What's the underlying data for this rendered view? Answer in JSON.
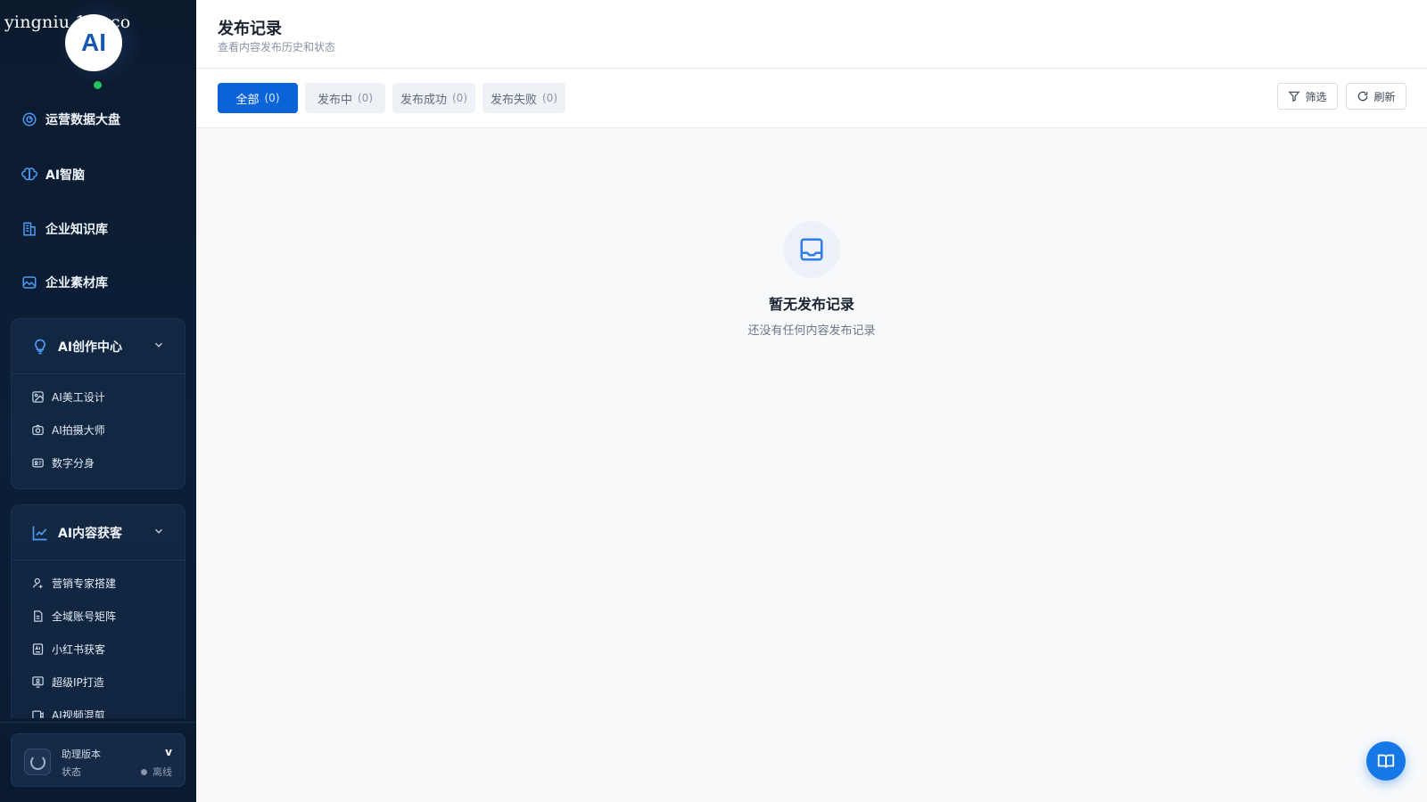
{
  "watermark": "yingniu.10v.co",
  "logo": {
    "text": "AI"
  },
  "nav": [
    {
      "label": "运营数据大盘",
      "icon": "dashboard-icon"
    },
    {
      "label": "AI智脑",
      "icon": "brain-icon"
    },
    {
      "label": "企业知识库",
      "icon": "building-icon"
    },
    {
      "label": "企业素材库",
      "icon": "image-icon"
    }
  ],
  "groups": {
    "creation": {
      "title": "AI创作中心",
      "icon": "lightbulb-icon",
      "items": [
        {
          "label": "AI美工设计",
          "icon": "palette-icon"
        },
        {
          "label": "AI拍摄大师",
          "icon": "camera-icon"
        },
        {
          "label": "数字分身",
          "icon": "id-card-icon"
        }
      ]
    },
    "acquisition": {
      "title": "AI内容获客",
      "icon": "trend-chart-icon",
      "items": [
        {
          "label": "营销专家搭建",
          "icon": "user-icon"
        },
        {
          "label": "全域账号矩阵",
          "icon": "file-icon"
        },
        {
          "label": "小红书获客",
          "icon": "ai-doc-icon"
        },
        {
          "label": "超级IP打造",
          "icon": "monitor-user-icon"
        },
        {
          "label": "AI视频混剪",
          "icon": "video-icon"
        }
      ]
    }
  },
  "status": {
    "title": "助理版本",
    "version": "v",
    "label": "状态",
    "state": "离线"
  },
  "header": {
    "title": "发布记录",
    "subtitle": "查看内容发布历史和状态"
  },
  "tabs": [
    {
      "label": "全部",
      "count": "(0)"
    },
    {
      "label": "发布中",
      "count": "(0)"
    },
    {
      "label": "发布成功",
      "count": "(0)"
    },
    {
      "label": "发布失败",
      "count": "(0)"
    }
  ],
  "actions": {
    "filter": "筛选",
    "refresh": "刷新"
  },
  "empty": {
    "title": "暂无发布记录",
    "description": "还没有任何内容发布记录"
  },
  "colors": {
    "accent": "#0b63d8",
    "sidebar_bg": "#0c1a2e",
    "online": "#22c55e"
  }
}
